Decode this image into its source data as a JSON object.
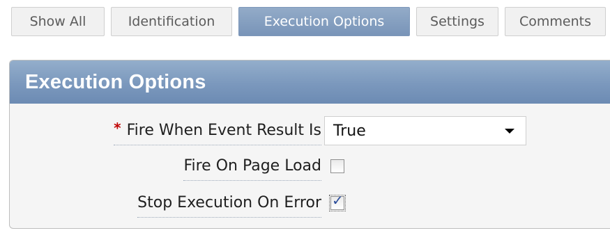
{
  "tabs": [
    {
      "label": "Show All",
      "active": false
    },
    {
      "label": "Identification",
      "active": false
    },
    {
      "label": "Execution Options",
      "active": true
    },
    {
      "label": "Settings",
      "active": false
    },
    {
      "label": "Comments",
      "active": false
    }
  ],
  "region": {
    "title": "Execution Options"
  },
  "form": {
    "fire_when": {
      "label": "Fire When Event Result Is",
      "required_marker": "*",
      "value": "True"
    },
    "fire_on_page_load": {
      "label": "Fire On Page Load",
      "checked": false
    },
    "stop_execution": {
      "label": "Stop Execution On Error",
      "checked": true,
      "check_glyph": "✓"
    }
  },
  "colors": {
    "active_tab": "#7f9bbf",
    "header": "#7b98bd",
    "required": "#c00000"
  }
}
